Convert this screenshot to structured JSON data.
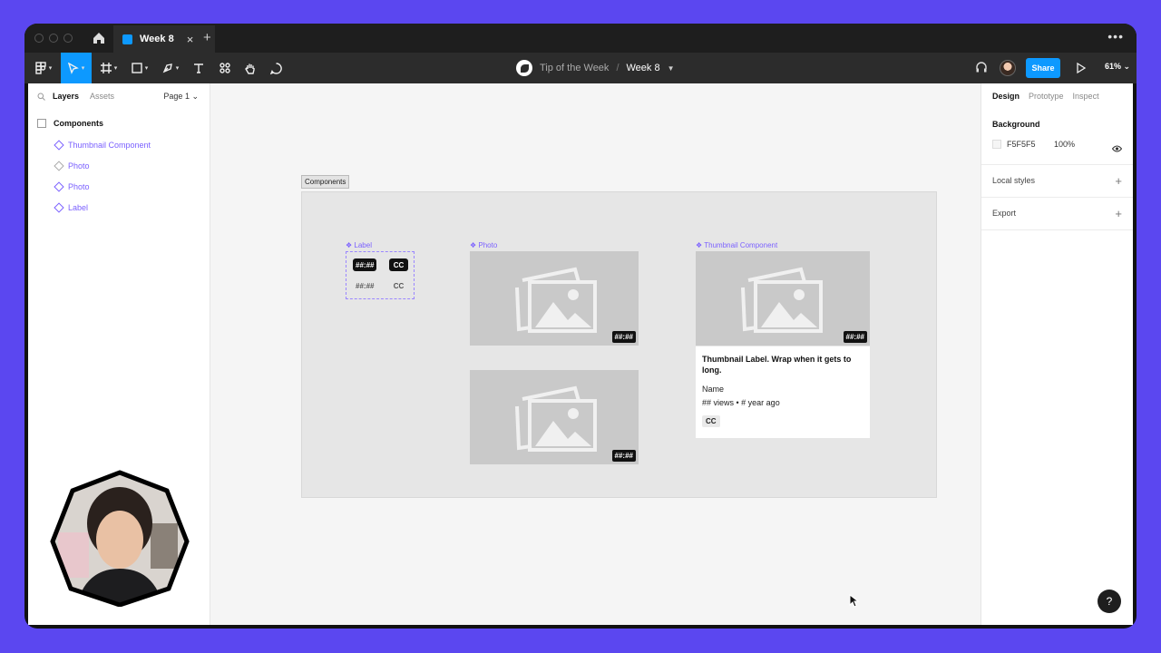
{
  "tabbar": {
    "tab_label": "Week 8",
    "tab_close": "×",
    "new_tab": "+",
    "more": "•••"
  },
  "toolbar": {
    "project": "Tip of the Week",
    "separator": "/",
    "file": "Week 8",
    "share_label": "Share",
    "zoom": "61%"
  },
  "left_panel": {
    "tabs": [
      "Layers",
      "Assets"
    ],
    "page": "Page 1 ⌄",
    "root_layer": "Components",
    "layers": [
      {
        "label": "Thumbnail Component",
        "kind": "component"
      },
      {
        "label": "Photo",
        "kind": "instance"
      },
      {
        "label": "Photo",
        "kind": "component"
      },
      {
        "label": "Label",
        "kind": "component"
      }
    ]
  },
  "canvas": {
    "section_label": "Components",
    "label_title": "❖ Label",
    "photo_title": "❖ Photo",
    "thumb_title": "❖ Thumbnail Component",
    "pill_duration": "##:##",
    "pill_cc": "CC",
    "card": {
      "title": "Thumbnail Label. Wrap when it gets to long.",
      "name": "Name",
      "meta": "## views • # year ago",
      "cc": "CC"
    }
  },
  "right_panel": {
    "tabs": [
      "Design",
      "Prototype",
      "Inspect"
    ],
    "background_heading": "Background",
    "bg_hex": "F5F5F5",
    "bg_opacity": "100%",
    "local_styles": "Local styles",
    "export": "Export",
    "plus": "+"
  },
  "help": "?",
  "colors": {
    "accent": "#0d99ff",
    "component": "#7b61ff",
    "backdrop": "#5b47f0"
  }
}
